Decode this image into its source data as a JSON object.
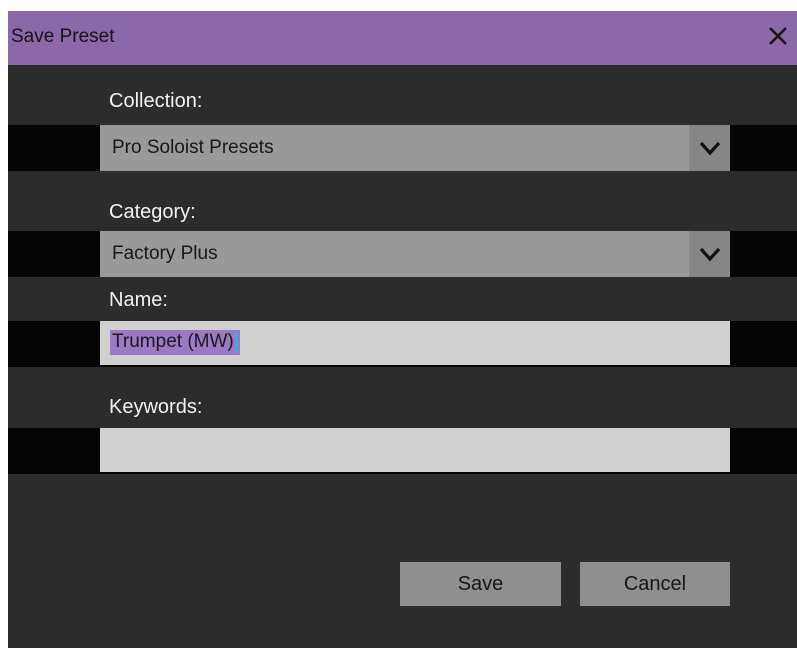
{
  "dialog": {
    "title": "Save Preset",
    "close_icon": "close-icon"
  },
  "collection": {
    "label": "Collection:",
    "value": "Pro Soloist Presets"
  },
  "category": {
    "label": "Category:",
    "value": "Factory Plus"
  },
  "name": {
    "label": "Name:",
    "value": "Trumpet (MW)"
  },
  "keywords": {
    "label": "Keywords:",
    "value": ""
  },
  "buttons": {
    "save": "Save",
    "cancel": "Cancel"
  },
  "colors": {
    "titlebar": "#8c68a8",
    "dialog_bg": "#2c2c2c",
    "selection": "#9b79c4"
  }
}
